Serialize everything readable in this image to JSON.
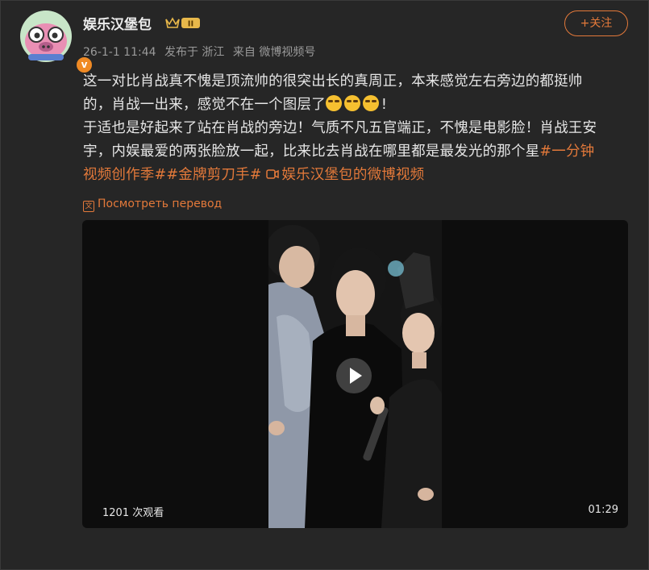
{
  "header": {
    "username": "娱乐汉堡包",
    "level_badge": "II",
    "timestamp": "26-1-1 11:44",
    "published_in": "发布于 浙江",
    "source": "来自 微博视频号",
    "follow_label": "+关注",
    "verified_mark": "v"
  },
  "post": {
    "line1": "这一对比肖战真不愧是顶流帅的很突出长的真周正，本来感觉左右旁边的都挺帅",
    "line2_text": "的，肖战一出来，感觉不在一个图层了",
    "line2_end": "!",
    "line3": "于适也是好起来了站在肖战的旁边！气质不凡五官端正，不愧是电影脸！肖战王安",
    "line4_text": "宇，内娱最爱的两张脸放一起，比来比去肖战在哪里都是最发光的那个星",
    "tag1_part1": "#一分钟",
    "tag1_part2": "视频创作季#",
    "tag2": "#金牌剪刀手#",
    "video_link": "娱乐汉堡包的微博视频",
    "emoji_name": "crying-face"
  },
  "translate_label": "Посмотреть перевод",
  "video": {
    "views": "1201 次观看",
    "duration": "01:29"
  },
  "colors": {
    "accent": "#e3793a",
    "background": "#262626"
  }
}
